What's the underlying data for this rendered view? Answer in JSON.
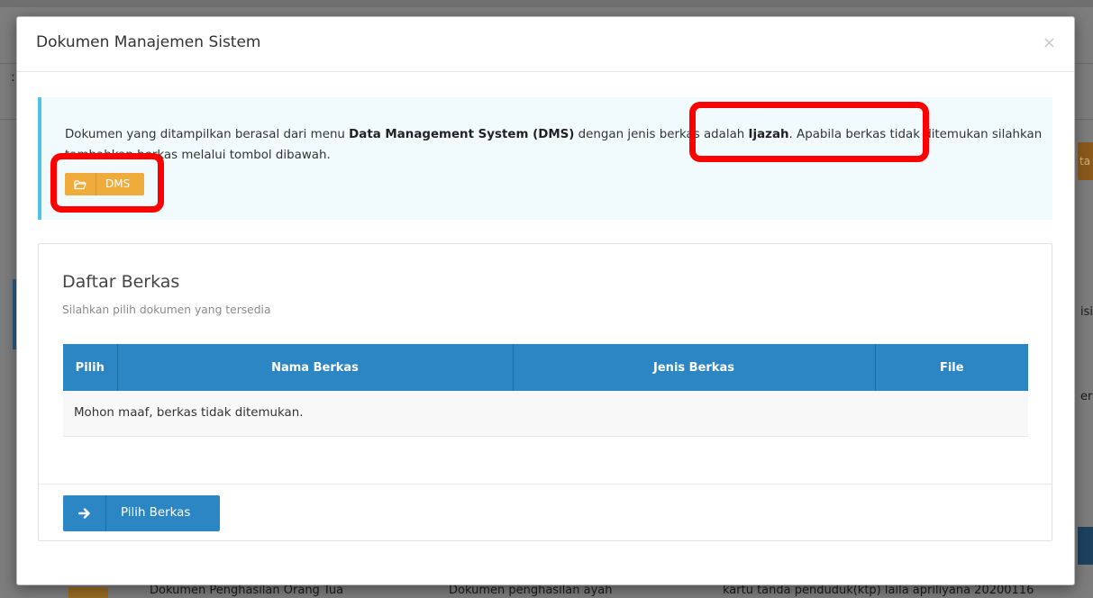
{
  "background": {
    "colon": ":",
    "right_orange_text": "ta",
    "right_text_1": "isi",
    "right_text_2": "er",
    "bottom_row": {
      "col1": "Dokumen Penghasilan Orang Tua",
      "col2": "Dokumen penghasilan ayah",
      "col3": "kartu tanda penduduk(ktp) laila apriliyana 20200116"
    }
  },
  "modal": {
    "title": "Dokumen Manajemen Sistem",
    "close_label": "×",
    "callout": {
      "text_1": "Dokumen yang ditampilkan berasal dari menu ",
      "text_bold_1": "Data Management System (DMS)",
      "text_2": " dengan jenis berkas adalah ",
      "text_bold_2": "Ijazah",
      "text_3": ". Apabila berkas tidak ditemukan silahkan tambahkan berkas melalui tombol dibawah.",
      "dms_button_label": "DMS",
      "dms_icon": "folder-open-icon",
      "accent_color": "#4ec4e0",
      "button_color": "#f0ac3b"
    },
    "panel": {
      "title": "Daftar Berkas",
      "subtitle": "Silahkan pilih dokumen yang tersedia",
      "table": {
        "columns": [
          "Pilih",
          "Nama Berkas",
          "Jenis Berkas",
          "File"
        ],
        "empty_message": "Mohon maaf, berkas tidak ditemukan.",
        "header_color": "#2d86c4"
      },
      "submit_button_label": "Pilih Berkas",
      "submit_icon": "arrow-right-icon"
    }
  },
  "annotations": {
    "color": "#ff0000"
  }
}
